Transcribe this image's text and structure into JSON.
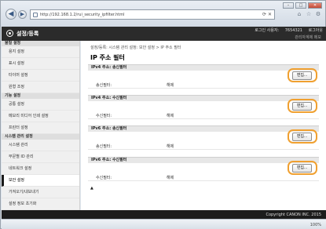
{
  "browser": {
    "address": "http://192.168.1.2/rui_security_ipfilter.html",
    "zoom": "100%"
  },
  "app": {
    "title": "설정/등록",
    "user_label": "로그인 사용자:",
    "user_id": "7654321",
    "logout": "로그아웃",
    "admin_mode": "관리자계제 메모"
  },
  "sidebar": {
    "sections": [
      {
        "title": "물질 설정",
        "items": [
          {
            "label": "용지 설정"
          },
          {
            "label": "표시 설정"
          },
          {
            "label": "타이머 설정"
          },
          {
            "label": "원형 조정"
          }
        ]
      },
      {
        "title": "기능 설정",
        "items": [
          {
            "label": "공통 설정"
          },
          {
            "label": "메모리 미디어 인쇄 설정"
          },
          {
            "label": "프린터 설정"
          }
        ]
      },
      {
        "title": "시스템 관리 설정",
        "items": [
          {
            "label": "시스템 관리"
          },
          {
            "label": "부문별 ID 관리"
          },
          {
            "label": "네트워크 설정"
          },
          {
            "label": "보안 설정"
          },
          {
            "label": "가져오기/내보내기"
          },
          {
            "label": "설정 정보 초기화"
          }
        ]
      }
    ]
  },
  "main": {
    "breadcrumb": "설정/등록: 시스템 관리 설정: 보안 설정 > IP 주소 필터",
    "title": "IP 주소 필터",
    "filters": [
      {
        "heading": "IPv4 주소: 송신필터",
        "label": "송신필터:",
        "value": "해제",
        "edit": "편집..."
      },
      {
        "heading": "IPv4 주소: 수신필터",
        "label": "수신필터:",
        "value": "해제",
        "edit": "편집..."
      },
      {
        "heading": "IPv6 주소: 송신필터",
        "label": "송신필터:",
        "value": "해제",
        "edit": "편집..."
      },
      {
        "heading": "IPv6 주소: 수신필터",
        "label": "수신필터:",
        "value": "해제",
        "edit": "편집..."
      }
    ],
    "page_top": "▲"
  },
  "footer": {
    "copyright": "Copyright CANON INC. 2015"
  }
}
